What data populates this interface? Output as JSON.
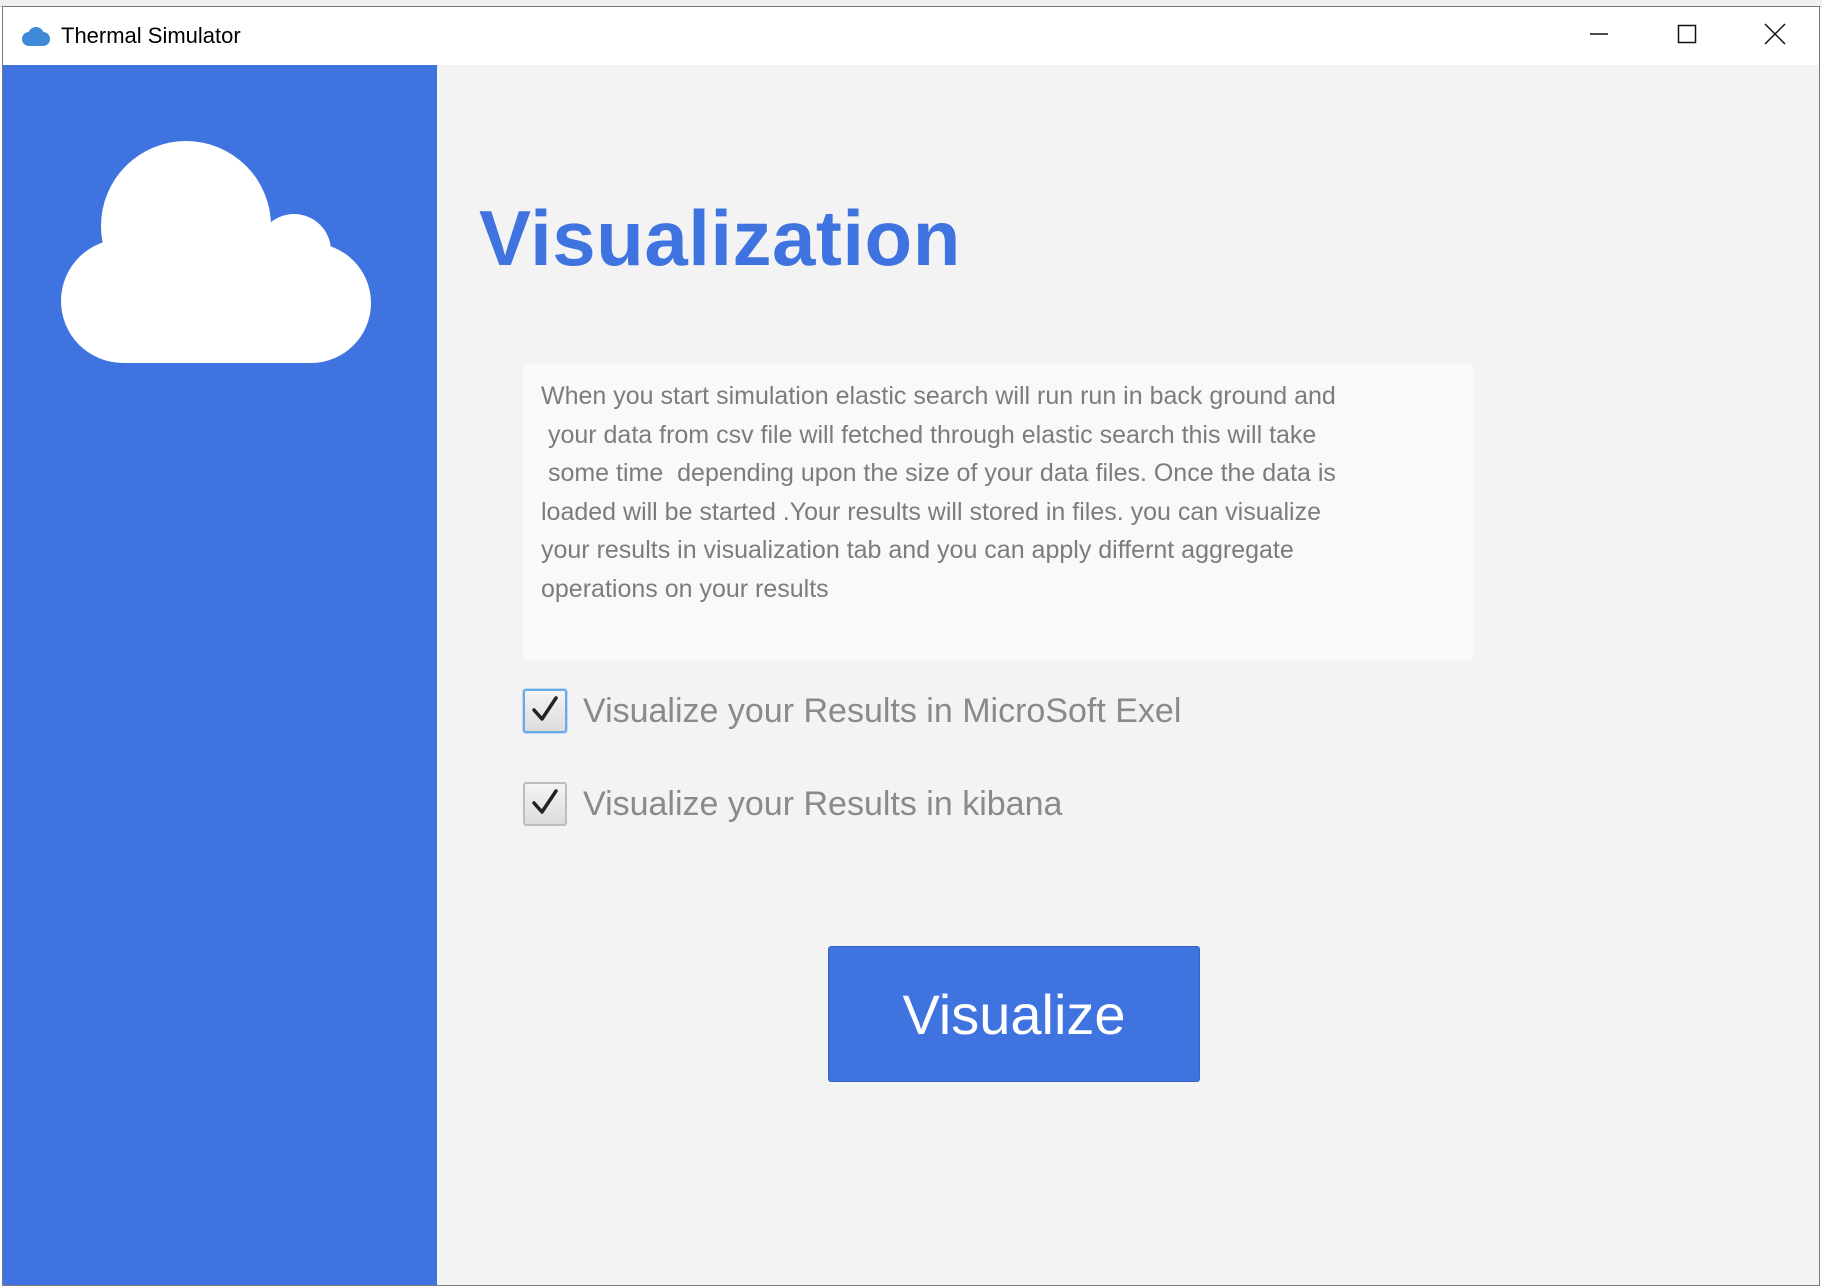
{
  "window": {
    "title": "Thermal Simulator",
    "app_icon": "cloud-icon"
  },
  "window_controls": {
    "minimize_icon": "minimize-icon",
    "maximize_icon": "maximize-icon",
    "close_icon": "close-icon"
  },
  "sidebar": {
    "logo_icon": "cloud-icon",
    "background_color": "#3e73e0"
  },
  "main": {
    "heading": "Visualization",
    "description": "When you start simulation elastic search will run run in back ground and\n your data from csv file will fetched through elastic search this will take\n some time  depending upon the size of your data files. Once the data is\nloaded will be started .Your results will stored in files. you can visualize\nyour results in visualization tab and you can apply differnt aggregate\noperations on your results",
    "options": [
      {
        "label": "Visualize your Results in MicroSoft Exel",
        "checked": true
      },
      {
        "label": "Visualize your Results in kibana",
        "checked": true
      }
    ],
    "visualize_button": "Visualize"
  },
  "colors": {
    "accent": "#3e73e0",
    "content_background": "#f3f3f3",
    "muted_text": "#7c7c7c"
  }
}
